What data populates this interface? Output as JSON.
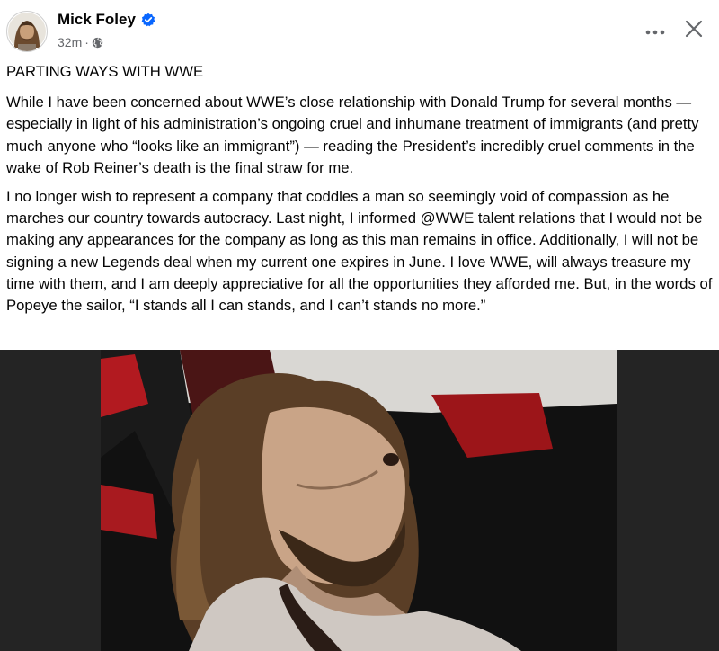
{
  "author": {
    "name": "Mick Foley",
    "verified": true,
    "verified_icon": "verified-badge-icon",
    "avatar_icon": "profile-avatar"
  },
  "meta": {
    "time": "32m",
    "separator": "·",
    "audience_icon": "globe-icon"
  },
  "actions": {
    "more_icon": "more-options-icon",
    "close_icon": "close-icon"
  },
  "post": {
    "paragraphs": [
      "PARTING WAYS WITH WWE",
      "While I have been concerned about WWE’s close relationship with Donald Trump for several months — especially in light of his administration’s ongoing cruel and inhumane treatment of immigrants (and pretty much anyone who “looks like an immigrant”) — reading the President’s incredibly cruel comments in the wake of Rob Reiner’s death is the final straw for me.",
      "I no longer wish to represent a company that coddles a man so seemingly void of compassion as he marches our country towards autocracy.  Last night, I informed @WWE talent relations that I would not be making any appearances for the company as long as this man remains in office. Additionally, I will not be signing a new Legends deal when my current one expires in June. I love WWE, will always treasure my time with them, and I am deeply appreciative for all the opportunities they afforded me. But, in the words of Popeye the sailor, “I stands all I can stands, and I can’t stands no more.”"
    ]
  },
  "colors": {
    "text_primary": "#050505",
    "text_secondary": "#65676b",
    "verified_blue": "#0866ff",
    "photo_bg": "#242424"
  }
}
